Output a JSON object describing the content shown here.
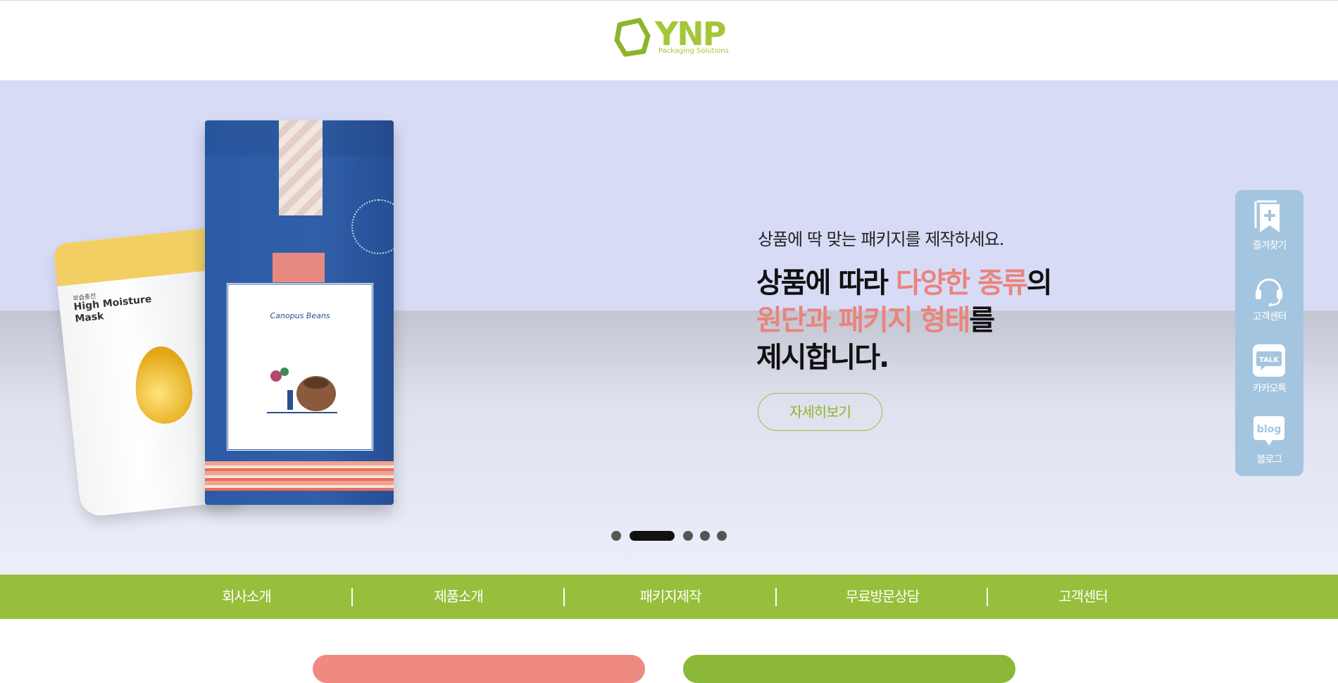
{
  "brand": {
    "logo_text": "YNP",
    "logo_subtitle": "Packaging Solutions",
    "color": "#a4c639"
  },
  "hero": {
    "subtitle": "상품에 딱 맞는 패키지를 제작하세요.",
    "headline": {
      "line1_a": "상품에 따라 ",
      "line1_accent": "다양한 종류",
      "line1_b": "의",
      "line2_accent": "원단과 패키지 형태",
      "line2_b": "를",
      "line3": "제시합니다."
    },
    "accent_color": "#e8857d",
    "more_button": "자세히보기",
    "product_pouch": {
      "small_text": "보습충전",
      "title": "High Moisture Mask"
    },
    "product_bag": {
      "brand": "Canopus Beans"
    },
    "slides": {
      "count": 5,
      "active_index": 1
    }
  },
  "quick_menu": {
    "items": [
      {
        "label": "즐겨찾기",
        "icon": "bookmark-add-icon"
      },
      {
        "label": "고객센터",
        "icon": "headset-icon"
      },
      {
        "label": "카카오톡",
        "icon": "kakaotalk-icon",
        "icon_text": "TALK"
      },
      {
        "label": "블로그",
        "icon": "blog-icon",
        "icon_text": "blog"
      }
    ],
    "background": "#a4c5df"
  },
  "nav": {
    "items": [
      "회사소개",
      "제품소개",
      "패키지제작",
      "무료방문상담",
      "고객센터"
    ],
    "background": "#97bf3b"
  }
}
